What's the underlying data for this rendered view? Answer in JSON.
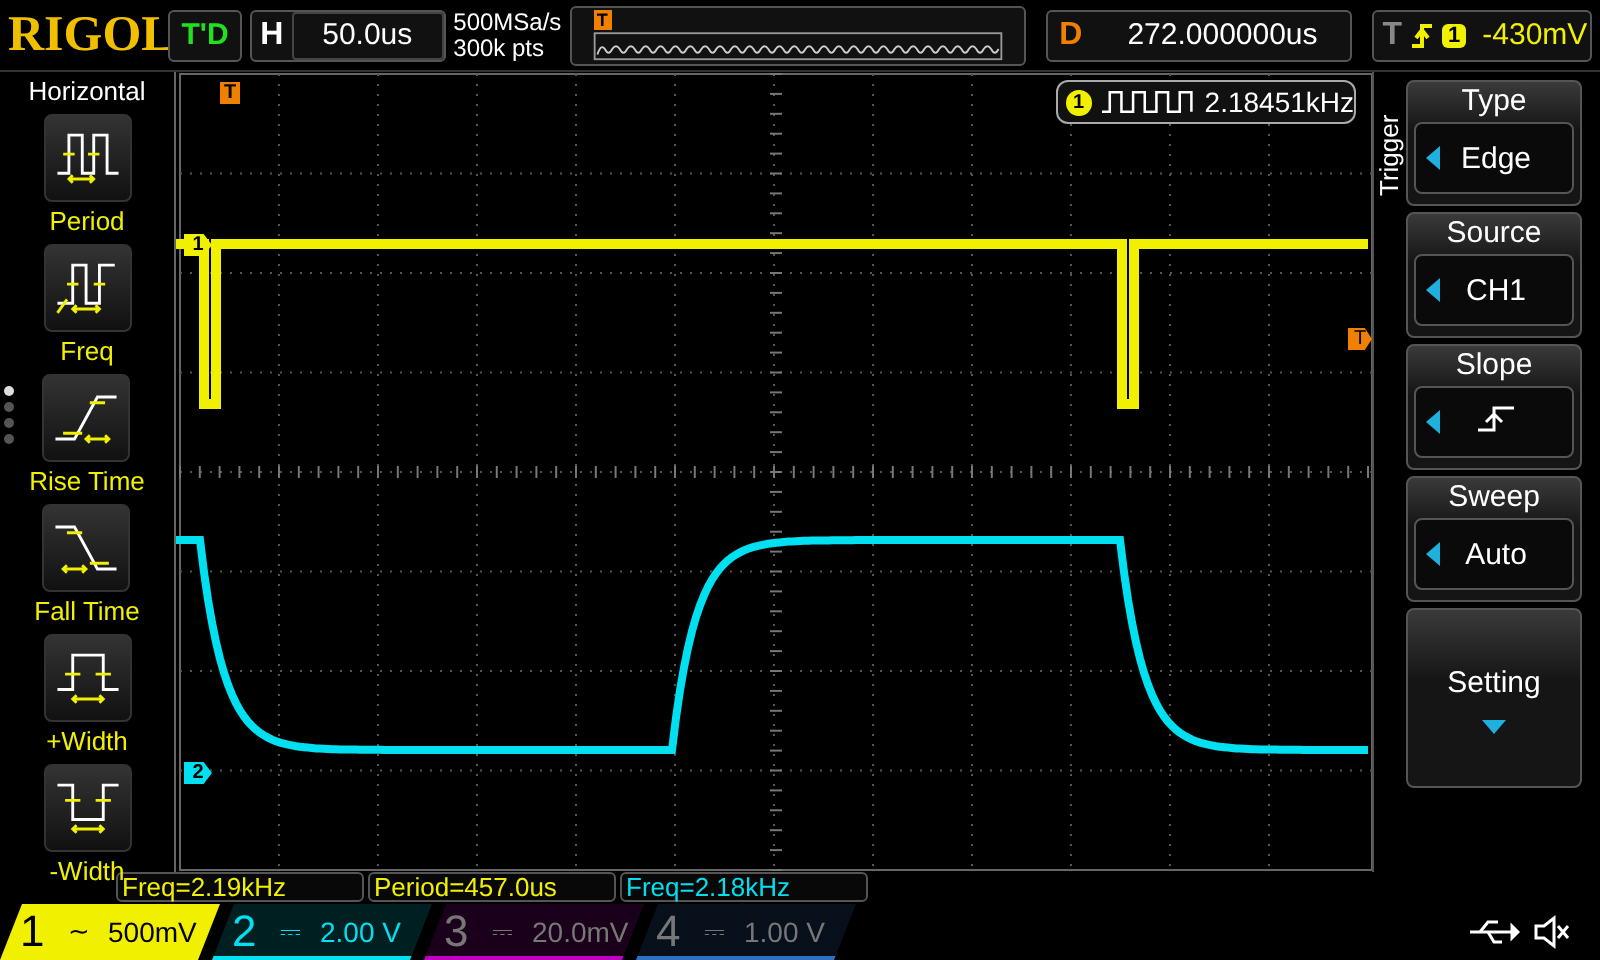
{
  "brand": "RIGOL",
  "trigger_status": "T'D",
  "timebase": {
    "label": "H",
    "value": "50.0us"
  },
  "sample_rate": "500MSa/s",
  "memory_depth": "300k pts",
  "position_marker": "T",
  "delay": {
    "label": "D",
    "value": "272.000000us"
  },
  "trigger": {
    "label": "T",
    "source": "1",
    "level": "-430mV"
  },
  "left_menu": {
    "title": "Horizontal",
    "items": [
      {
        "label": "Period",
        "kind": "period"
      },
      {
        "label": "Freq",
        "kind": "freq"
      },
      {
        "label": "Rise Time",
        "kind": "rise"
      },
      {
        "label": "Fall Time",
        "kind": "fall"
      },
      {
        "label": "+Width",
        "kind": "pwidth"
      },
      {
        "label": "-Width",
        "kind": "nwidth"
      }
    ],
    "pages": [
      {
        "selected": true
      },
      {
        "selected": false
      },
      {
        "selected": false
      },
      {
        "selected": false
      }
    ]
  },
  "screen": {
    "trigger_position": "T",
    "trigger_level": "T",
    "markers": [
      {
        "label": "1",
        "color": "#f0f000"
      },
      {
        "label": "2",
        "color": "#00e0f0"
      }
    ],
    "counter": {
      "channel": "1",
      "value": "2.18451kHz"
    }
  },
  "right_menu": {
    "title": "Trigger",
    "items": [
      {
        "kind": "value",
        "label": "Type",
        "value": "Edge"
      },
      {
        "kind": "value",
        "label": "Source",
        "value": "CH1"
      },
      {
        "kind": "slope",
        "label": "Slope"
      },
      {
        "kind": "value",
        "label": "Sweep",
        "value": "Auto"
      },
      {
        "kind": "more",
        "label": "Setting"
      }
    ]
  },
  "measurements": [
    {
      "text": "Freq=2.19kHz",
      "color": "#f0f000"
    },
    {
      "text": "Period=457.0us",
      "color": "#f0f000"
    },
    {
      "text": "Freq=2.18kHz",
      "color": "#00e0f0"
    }
  ],
  "channels": [
    {
      "number": "1",
      "coupling": "~",
      "scale": "500mV",
      "on": true,
      "selected": true,
      "color": "#f0f000"
    },
    {
      "number": "2",
      "coupling": "⎓",
      "scale": "2.00 V",
      "on": true,
      "selected": false,
      "color": "#00e0f0"
    },
    {
      "number": "3",
      "coupling": "⎓",
      "scale": "20.0mV",
      "on": false,
      "selected": false,
      "color": "#c000c0"
    },
    {
      "number": "4",
      "coupling": "⎓",
      "scale": "1.00 V",
      "on": false,
      "selected": false,
      "color": "#3070c0"
    }
  ]
}
